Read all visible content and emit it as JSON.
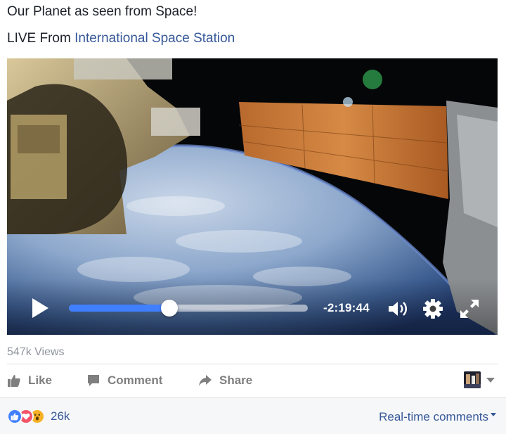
{
  "post": {
    "title": "Our Planet as seen from Space!",
    "live_prefix": "LIVE From",
    "live_link": "International Space Station"
  },
  "video": {
    "time_remaining": "-2:19:44",
    "progress_fraction": 0.42,
    "accent_color": "#4080ff",
    "icons": [
      "play-icon",
      "volume-icon",
      "gear-icon",
      "fullscreen-icon"
    ]
  },
  "stats": {
    "views": "547k Views"
  },
  "actions": {
    "like": "Like",
    "comment": "Comment",
    "share": "Share"
  },
  "footer": {
    "reaction_count": "26k",
    "reactions": [
      "like",
      "love",
      "wow"
    ],
    "realtime_label": "Real-time comments"
  },
  "colors": {
    "link": "#365899",
    "muted": "#90949c",
    "like_blue": "#4080ff",
    "love_red": "#f25268",
    "wow_yellow": "#f7b125"
  }
}
